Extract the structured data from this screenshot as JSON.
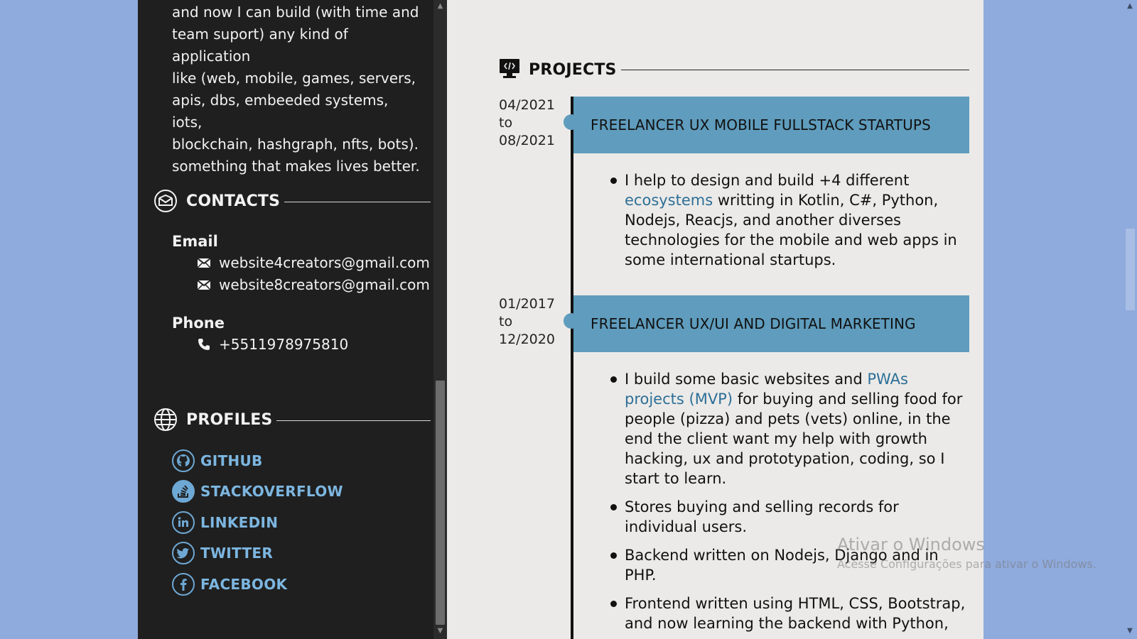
{
  "sidebar": {
    "intro_lines": [
      "and now I can build (with time and",
      "team suport) any kind of application",
      "like (web, mobile, games, servers,",
      "apis, dbs, embeeded systems, iots,",
      "blockchain, hashgraph, nfts, bots).",
      "something that makes lives better."
    ],
    "contacts": {
      "heading": "CONTACTS",
      "email_label": "Email",
      "emails": [
        "website4creators@gmail.com",
        "website8creators@gmail.com"
      ],
      "phone_label": "Phone",
      "phone": "+5511978975810"
    },
    "profiles": {
      "heading": "PROFILES",
      "items": [
        {
          "label": "GITHUB",
          "icon": "github-icon"
        },
        {
          "label": "STACKOVERFLOW",
          "icon": "stackoverflow-icon"
        },
        {
          "label": "LINKEDIN",
          "icon": "linkedin-icon"
        },
        {
          "label": "TWITTER",
          "icon": "twitter-icon"
        },
        {
          "label": "FACEBOOK",
          "icon": "facebook-icon"
        }
      ]
    }
  },
  "main": {
    "section_title": "PROJECTS",
    "projects": [
      {
        "date_from": "04/2021",
        "date_to_word": "to",
        "date_to": "08/2021",
        "title": "FREELANCER UX MOBILE FULLSTACK STARTUPS",
        "bullets": [
          {
            "before": "I help to design and build +4 different",
            "link": "ecosystems",
            "after": "writting in Kotlin, C#, Python, Nodejs, Reacjs, and another diverses technologies for the mobile and web apps in some international startups."
          }
        ]
      },
      {
        "date_from": "01/2017",
        "date_to_word": "to",
        "date_to": "12/2020",
        "title": "FREELANCER UX/UI AND DIGITAL MARKETING",
        "bullets": [
          {
            "before": "I build some basic websites and",
            "link": "PWAs projects (MVP)",
            "after": "for buying and selling food for people (pizza) and pets (vets) online, in the end the client want my help with growth hacking, ux and prototypation, coding, so I start to learn."
          },
          {
            "before": "Stores buying and selling records for individual users.",
            "link": "",
            "after": ""
          },
          {
            "before": "Backend written on Nodejs, Django and in PHP.",
            "link": "",
            "after": ""
          },
          {
            "before": "Frontend written using HTML, CSS, Bootstrap, and now learning the backend with Python,",
            "link": "",
            "after": ""
          }
        ]
      }
    ]
  },
  "watermark": {
    "line1": "Ativar o Windows",
    "line2": "Acesse Configurações para ativar o Windows."
  },
  "colors": {
    "page_bg": "#8faadc",
    "sidebar_bg": "#1f1f1f",
    "main_bg": "#ebeae8",
    "accent": "#5f9cbd",
    "link": "#2d6f97",
    "profile_link": "#7cb6e0"
  }
}
